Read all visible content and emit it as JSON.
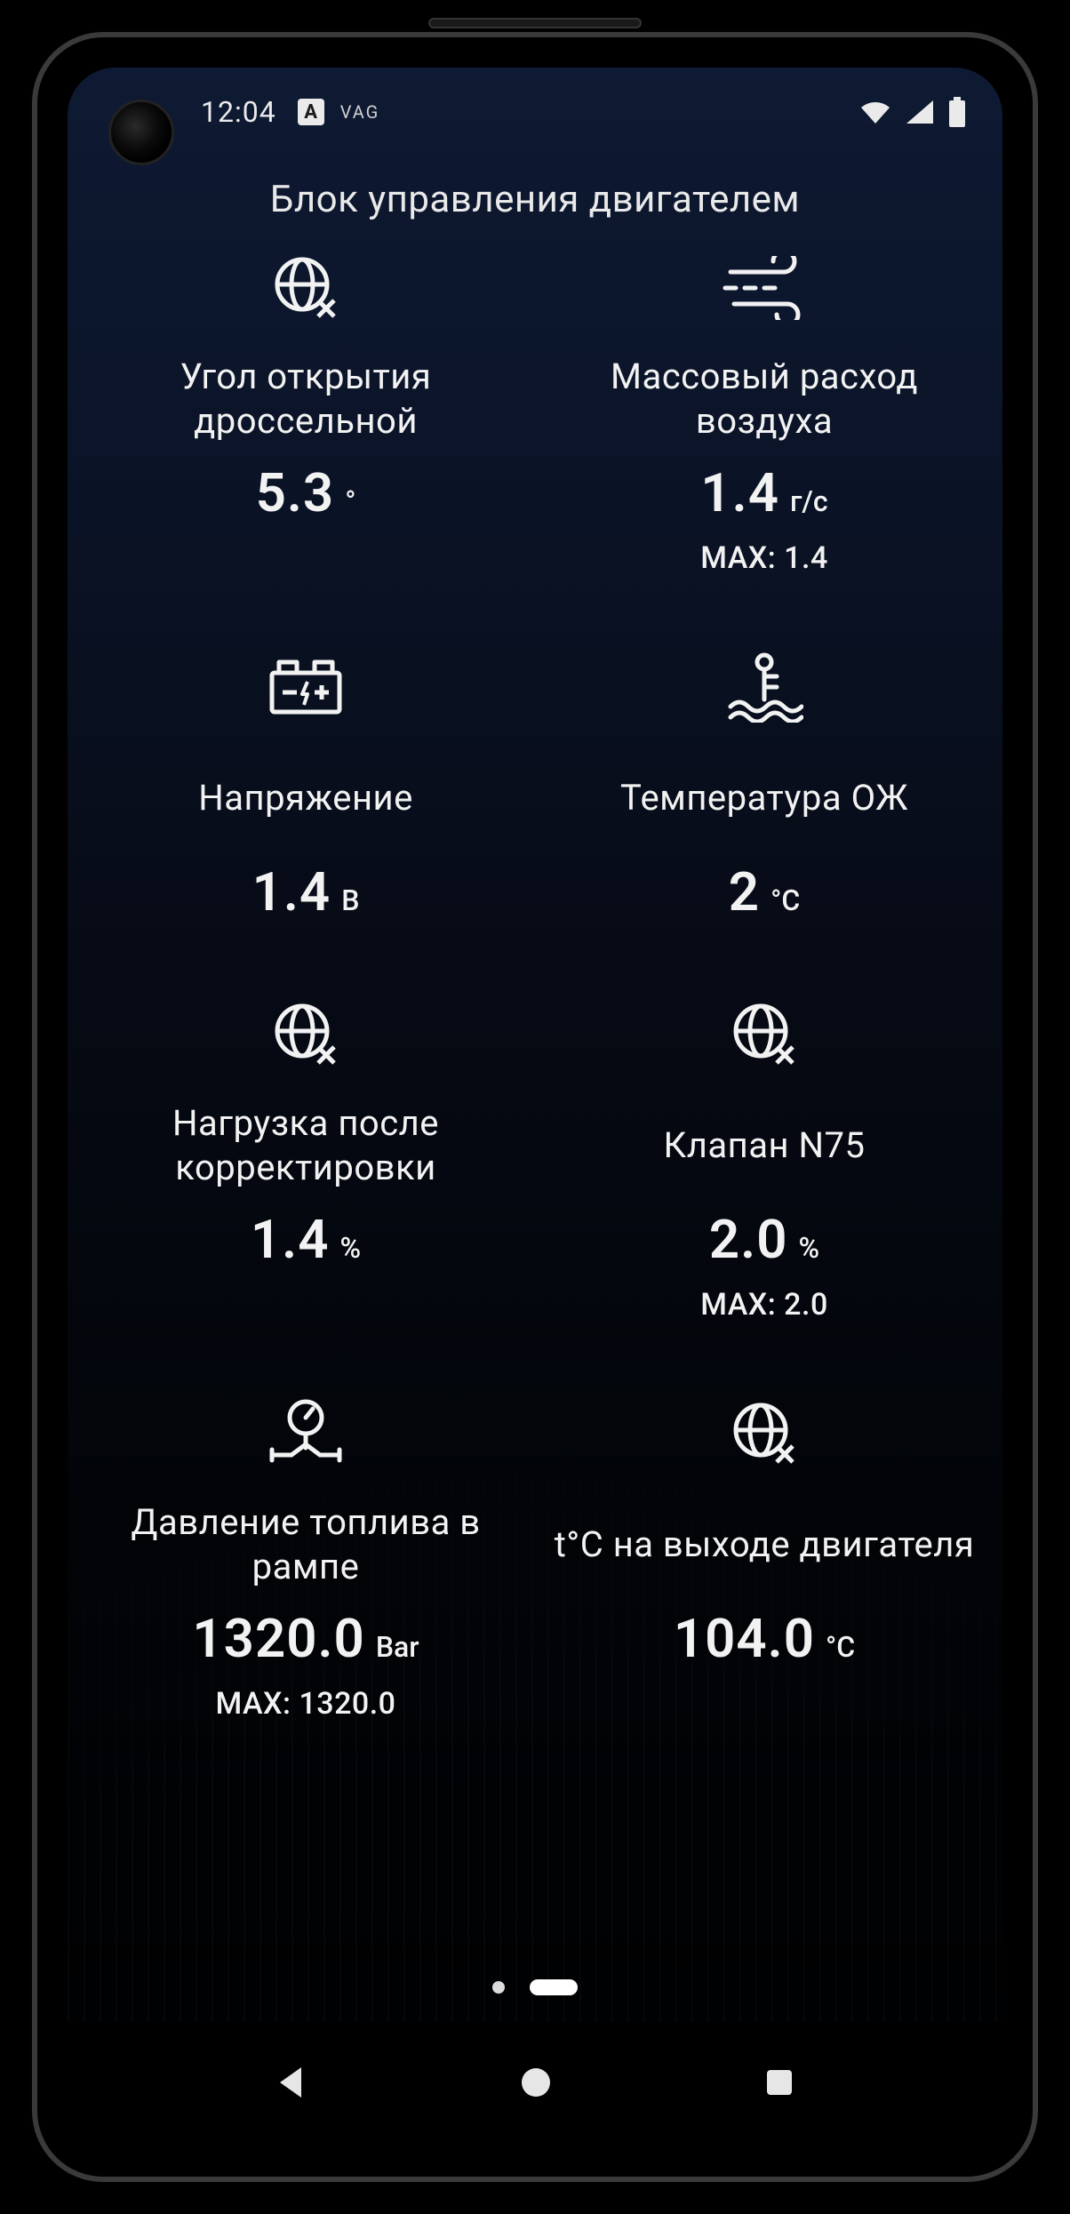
{
  "status": {
    "time": "12:04",
    "badge": "A",
    "carrier": "VAG"
  },
  "title": "Блок управления двигателем",
  "tiles": [
    {
      "icon": "globe-x",
      "label": "Угол открытия дроссельной",
      "value": "5.3",
      "unit": "°"
    },
    {
      "icon": "wind",
      "label": "Массовый расход воздуха",
      "value": "1.4",
      "unit": "г/с",
      "max_label": "MAX:",
      "max": "1.4"
    },
    {
      "icon": "battery",
      "label": "Напряжение",
      "value": "1.4",
      "unit": "В"
    },
    {
      "icon": "temp",
      "label": "Температура ОЖ",
      "value": "2",
      "unit": "°C"
    },
    {
      "icon": "globe-x",
      "label": "Нагрузка после корректировки",
      "value": "1.4",
      "unit": "%"
    },
    {
      "icon": "globe-x",
      "label": "Клапан N75",
      "value": "2.0",
      "unit": "%",
      "max_label": "MAX:",
      "max": "2.0"
    },
    {
      "icon": "gauge",
      "label": "Давление топлива в рампе",
      "value": "1320.0",
      "unit": "Bar",
      "max_label": "MAX:",
      "max": "1320.0"
    },
    {
      "icon": "globe-x",
      "label": "t°C на выходе двигателя",
      "value": "104.0",
      "unit": "°C"
    }
  ]
}
